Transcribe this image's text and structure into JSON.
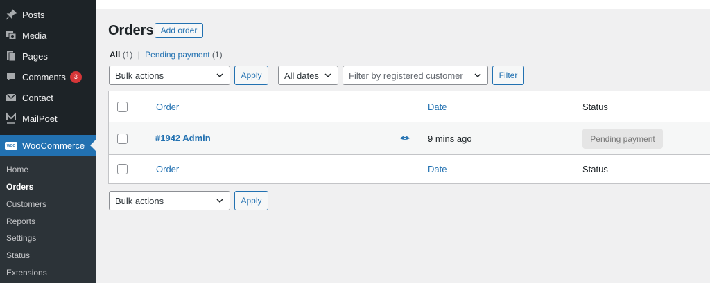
{
  "sidebar": {
    "items": [
      {
        "label": "Posts",
        "icon": "pin-icon"
      },
      {
        "label": "Media",
        "icon": "media-icon"
      },
      {
        "label": "Pages",
        "icon": "pages-icon"
      },
      {
        "label": "Comments",
        "icon": "comment-icon",
        "badge": "3"
      },
      {
        "label": "Contact",
        "icon": "envelope-icon"
      },
      {
        "label": "MailPoet",
        "icon": "mailpoet-icon"
      }
    ],
    "active": {
      "label": "WooCommerce",
      "icon": "woocommerce-icon",
      "icon_text": "WOO"
    },
    "submenu": [
      "Home",
      "Orders",
      "Customers",
      "Reports",
      "Settings",
      "Status",
      "Extensions"
    ],
    "submenu_current": "Orders"
  },
  "page": {
    "title": "Orders",
    "add_button": "Add order"
  },
  "views": {
    "all_label": "All",
    "all_count": "(1)",
    "separator": "|",
    "pending_label": "Pending payment",
    "pending_count": "(1)"
  },
  "filters": {
    "bulk_actions": "Bulk actions",
    "apply": "Apply",
    "dates": "All dates",
    "customer_placeholder": "Filter by registered customer",
    "filter_button": "Filter"
  },
  "table": {
    "columns": {
      "order": "Order",
      "date": "Date",
      "status": "Status"
    },
    "rows": [
      {
        "order": "#1942 Admin",
        "date": "9 mins ago",
        "status": "Pending payment"
      }
    ]
  },
  "colors": {
    "sidebar_bg": "#1d2327",
    "accent": "#2271b1",
    "badge": "#d63638",
    "status_pending_bg": "#e5e5e5"
  }
}
